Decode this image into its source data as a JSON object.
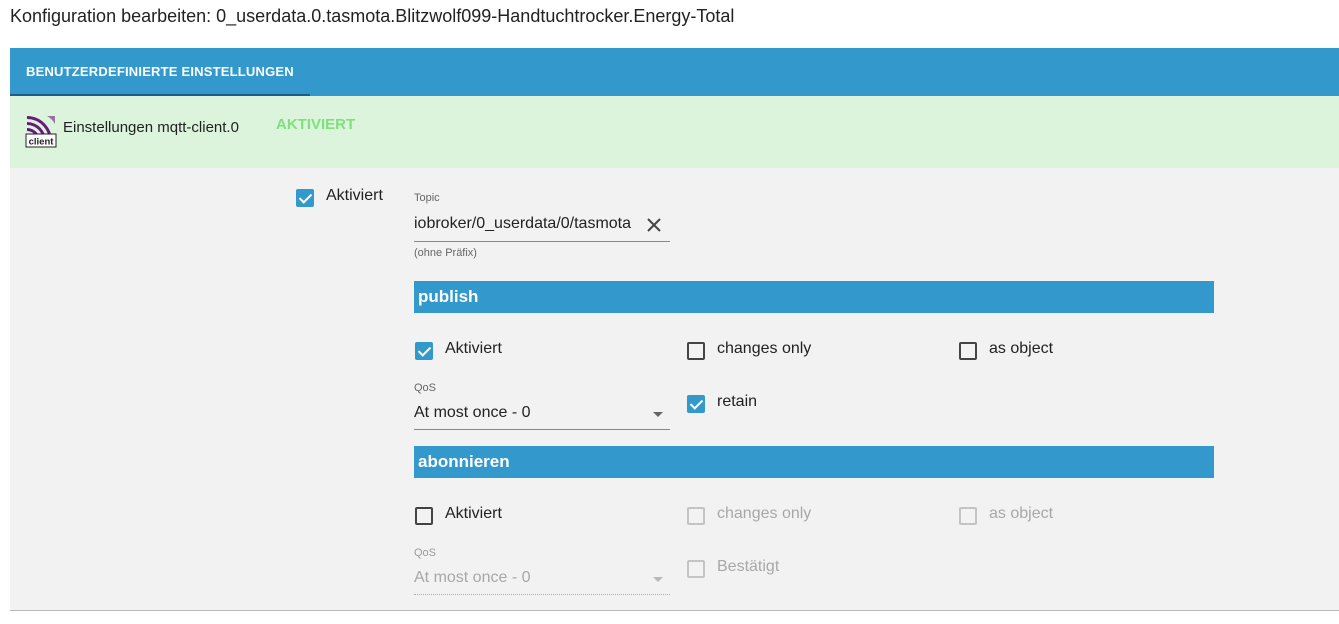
{
  "page": {
    "title": "Konfiguration bearbeiten: 0_userdata.0.tasmota.Blitzwolf099-Handtuchtrocker.Energy-Total"
  },
  "tabs": [
    {
      "label": "BENUTZERDEFINIERTE EINSTELLUNGEN",
      "active": true
    }
  ],
  "adapter": {
    "logo_text": "client",
    "name": "Einstellungen mqtt-client.0",
    "status": "AKTIVIERT"
  },
  "main": {
    "enabled_label": "Aktiviert",
    "enabled": true,
    "topic": {
      "label": "Topic",
      "value": "iobroker/0_userdata/0/tasmota",
      "hint": "(ohne Präfix)"
    }
  },
  "publish": {
    "title": "publish",
    "enabled": {
      "label": "Aktiviert",
      "checked": true
    },
    "changes_only": {
      "label": "changes only",
      "checked": false
    },
    "as_object": {
      "label": "as object",
      "checked": false
    },
    "qos": {
      "label": "QoS",
      "value": "At most once - 0"
    },
    "retain": {
      "label": "retain",
      "checked": true
    }
  },
  "subscribe": {
    "title": "abonnieren",
    "enabled": {
      "label": "Aktiviert",
      "checked": false
    },
    "changes_only": {
      "label": "changes only",
      "checked": false,
      "disabled": true
    },
    "as_object": {
      "label": "as object",
      "checked": false,
      "disabled": true
    },
    "qos": {
      "label": "QoS",
      "value": "At most once - 0",
      "disabled": true
    },
    "ack": {
      "label": "Bestätigt",
      "checked": false,
      "disabled": true
    }
  },
  "colors": {
    "accent": "#3399cc",
    "active_header_bg": "#dcf4dc",
    "status_green": "#7ee07e",
    "panel_bg": "#f2f2f2"
  }
}
